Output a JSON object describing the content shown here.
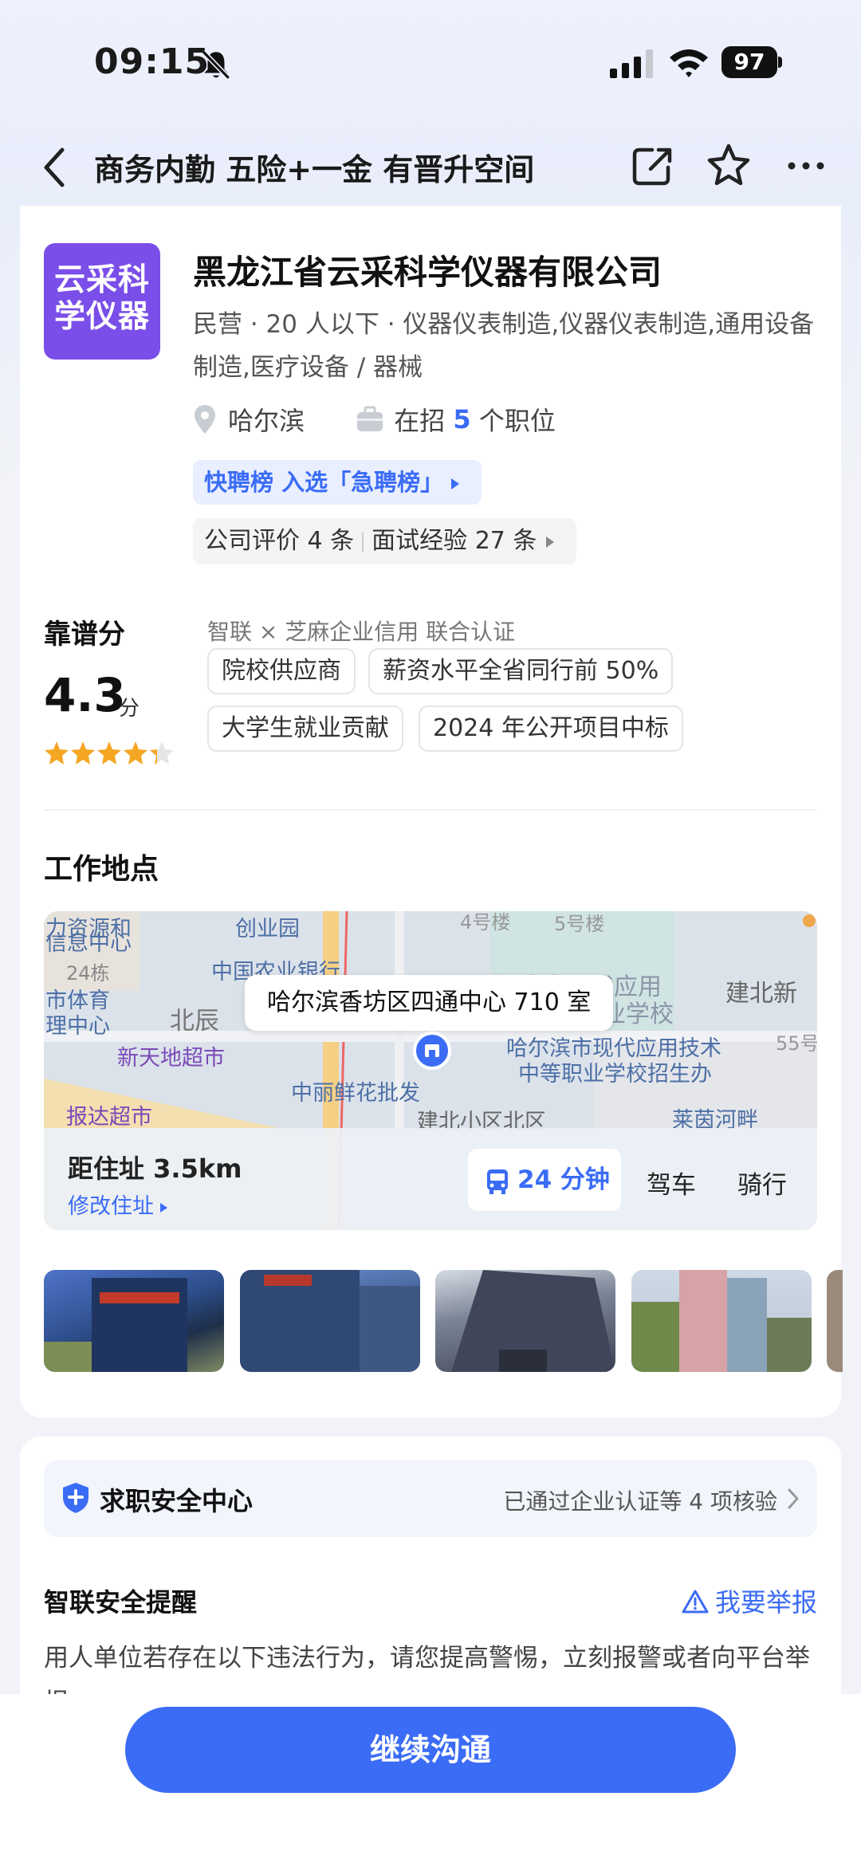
{
  "status_bar": {
    "time": "09:15",
    "battery": "97"
  },
  "nav": {
    "title": "商务内勤 五险+一金 有晋升空间"
  },
  "company": {
    "logo_line1": "云采科",
    "logo_line2": "学仪器",
    "name": "黑龙江省云采科学仪器有限公司",
    "description": "民营 · 20 人以下 · 仪器仪表制造,仪器仪表制造,通用设备制造,医疗设备 / 器械",
    "city": "哈尔滨",
    "jobs_prefix": "在招 ",
    "jobs_count": "5",
    "jobs_suffix": " 个职位",
    "rank_chip": "快聘榜 入选「急聘榜」",
    "review_count_text": "公司评价 4 条",
    "interview_text": "面试经验 27 条"
  },
  "score": {
    "title": "靠谱分",
    "value": "4.3",
    "unit": "分",
    "stars": 4.3,
    "cert_text": "智联 × 芝麻企业信用 联合认证",
    "tags": [
      "院校供应商",
      "薪资水平全省同行前 50%",
      "大学生就业贡献",
      "2024 年公开项目中标"
    ]
  },
  "work_location": {
    "title": "工作地点",
    "address": "哈尔滨香坊区四通中心 710 室",
    "map_labels": [
      "力资源和",
      "信息中心",
      "24栋",
      "创业园",
      "4号楼",
      "5号楼",
      "中国农业银行",
      "哈尔滨市现代应用",
      "业学校",
      "建北新",
      "市体育",
      "理中心",
      "北辰",
      "新天地超市",
      "哈尔滨市现代应用技术",
      "中等职业学校招生办",
      "55号",
      "中丽鲜花批发",
      "报达超市",
      "建北小区北区",
      "莱茵河畔"
    ],
    "distance": "距住址 3.5km",
    "modify": "修改住址",
    "transit": "24 分钟",
    "drive": "驾车",
    "ride": "骑行"
  },
  "safety": {
    "title": "求职安全中心",
    "status": "已通过企业认证等 4 项核验",
    "reminder_title": "智联安全提醒",
    "report": "我要举报",
    "reminder_text": "用人单位若存在以下违法行为，请您提高警惕，立刻报警或者向平台举报："
  },
  "cta": {
    "label": "继续沟通"
  },
  "colors": {
    "accent": "#3b6cf6",
    "logo_bg": "#7a4ee8",
    "star": "#f5a623"
  }
}
